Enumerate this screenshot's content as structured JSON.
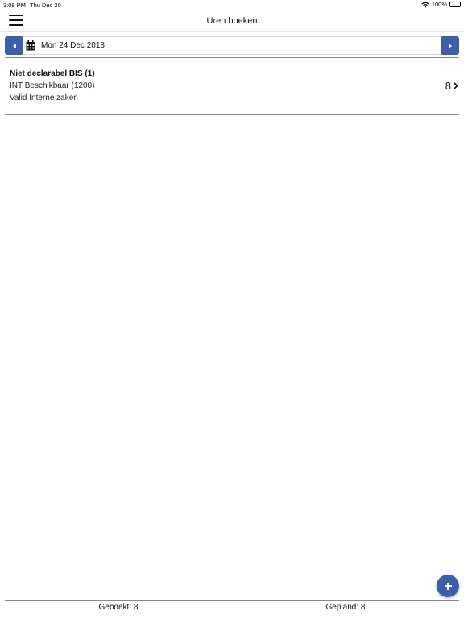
{
  "status_bar": {
    "time": "3:08 PM",
    "date": "Thu Dec 20",
    "battery": "100%",
    "battery_level": 1.0
  },
  "header": {
    "title": "Uren boeken",
    "menu_icon": "hamburger-menu-icon"
  },
  "date_nav": {
    "date": "Mon 24 Dec 2018",
    "prev_icon": "caret-left-icon",
    "next_icon": "caret-right-icon",
    "calendar_icon": "calendar-icon"
  },
  "entries": [
    {
      "title": "Niet declarabel BIS (1)",
      "line2": "INT Beschikbaar (1200)",
      "line3": "Valid Interne zaken",
      "hours": "8"
    }
  ],
  "footer": {
    "booked": "Geboekt: 8",
    "planned": "Gepland: 8"
  },
  "colors": {
    "accent": "#3b5fa9",
    "divider": "#8a8a8a"
  },
  "fab_icon": "plus-icon"
}
